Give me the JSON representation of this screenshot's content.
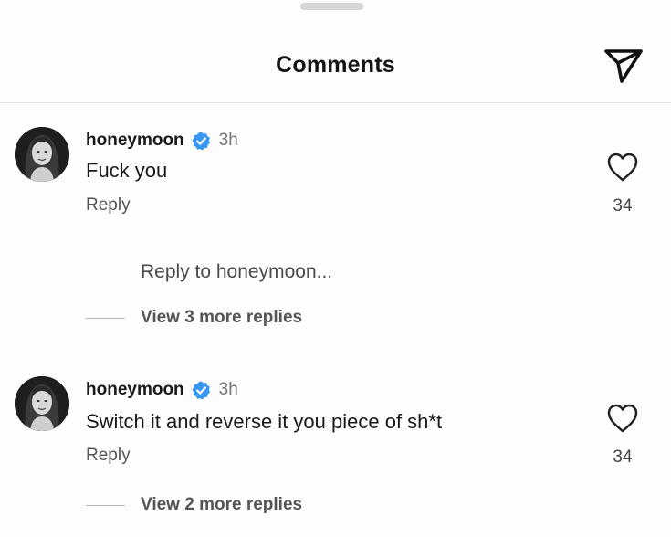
{
  "header": {
    "title": "Comments",
    "share_icon": "send-paper-plane-icon"
  },
  "comments": [
    {
      "username": "honeymoon",
      "verified": true,
      "timestamp": "3h",
      "text": "Fuck you",
      "reply_label": "Reply",
      "like_count": "34",
      "reply_prompt": "Reply to honeymoon...",
      "view_replies": "View 3 more replies"
    },
    {
      "username": "honeymoon",
      "verified": true,
      "timestamp": "3h",
      "text": "Switch it and reverse it you piece of sh*t",
      "reply_label": "Reply",
      "like_count": "34",
      "view_replies": "View 2 more replies"
    }
  ],
  "colors": {
    "verified_badge": "#3897f0",
    "muted_text": "#737373"
  }
}
